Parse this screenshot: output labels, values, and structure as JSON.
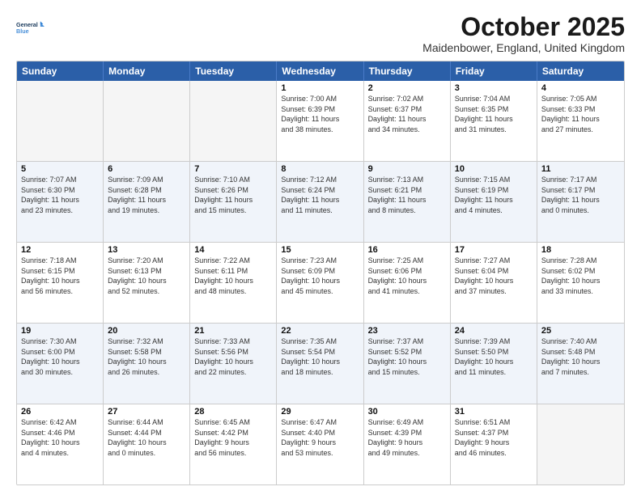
{
  "logo": {
    "line1": "General",
    "line2": "Blue"
  },
  "title": "October 2025",
  "location": "Maidenbower, England, United Kingdom",
  "weekdays": [
    "Sunday",
    "Monday",
    "Tuesday",
    "Wednesday",
    "Thursday",
    "Friday",
    "Saturday"
  ],
  "weeks": [
    [
      {
        "day": "",
        "info": ""
      },
      {
        "day": "",
        "info": ""
      },
      {
        "day": "",
        "info": ""
      },
      {
        "day": "1",
        "info": "Sunrise: 7:00 AM\nSunset: 6:39 PM\nDaylight: 11 hours\nand 38 minutes."
      },
      {
        "day": "2",
        "info": "Sunrise: 7:02 AM\nSunset: 6:37 PM\nDaylight: 11 hours\nand 34 minutes."
      },
      {
        "day": "3",
        "info": "Sunrise: 7:04 AM\nSunset: 6:35 PM\nDaylight: 11 hours\nand 31 minutes."
      },
      {
        "day": "4",
        "info": "Sunrise: 7:05 AM\nSunset: 6:33 PM\nDaylight: 11 hours\nand 27 minutes."
      }
    ],
    [
      {
        "day": "5",
        "info": "Sunrise: 7:07 AM\nSunset: 6:30 PM\nDaylight: 11 hours\nand 23 minutes."
      },
      {
        "day": "6",
        "info": "Sunrise: 7:09 AM\nSunset: 6:28 PM\nDaylight: 11 hours\nand 19 minutes."
      },
      {
        "day": "7",
        "info": "Sunrise: 7:10 AM\nSunset: 6:26 PM\nDaylight: 11 hours\nand 15 minutes."
      },
      {
        "day": "8",
        "info": "Sunrise: 7:12 AM\nSunset: 6:24 PM\nDaylight: 11 hours\nand 11 minutes."
      },
      {
        "day": "9",
        "info": "Sunrise: 7:13 AM\nSunset: 6:21 PM\nDaylight: 11 hours\nand 8 minutes."
      },
      {
        "day": "10",
        "info": "Sunrise: 7:15 AM\nSunset: 6:19 PM\nDaylight: 11 hours\nand 4 minutes."
      },
      {
        "day": "11",
        "info": "Sunrise: 7:17 AM\nSunset: 6:17 PM\nDaylight: 11 hours\nand 0 minutes."
      }
    ],
    [
      {
        "day": "12",
        "info": "Sunrise: 7:18 AM\nSunset: 6:15 PM\nDaylight: 10 hours\nand 56 minutes."
      },
      {
        "day": "13",
        "info": "Sunrise: 7:20 AM\nSunset: 6:13 PM\nDaylight: 10 hours\nand 52 minutes."
      },
      {
        "day": "14",
        "info": "Sunrise: 7:22 AM\nSunset: 6:11 PM\nDaylight: 10 hours\nand 48 minutes."
      },
      {
        "day": "15",
        "info": "Sunrise: 7:23 AM\nSunset: 6:09 PM\nDaylight: 10 hours\nand 45 minutes."
      },
      {
        "day": "16",
        "info": "Sunrise: 7:25 AM\nSunset: 6:06 PM\nDaylight: 10 hours\nand 41 minutes."
      },
      {
        "day": "17",
        "info": "Sunrise: 7:27 AM\nSunset: 6:04 PM\nDaylight: 10 hours\nand 37 minutes."
      },
      {
        "day": "18",
        "info": "Sunrise: 7:28 AM\nSunset: 6:02 PM\nDaylight: 10 hours\nand 33 minutes."
      }
    ],
    [
      {
        "day": "19",
        "info": "Sunrise: 7:30 AM\nSunset: 6:00 PM\nDaylight: 10 hours\nand 30 minutes."
      },
      {
        "day": "20",
        "info": "Sunrise: 7:32 AM\nSunset: 5:58 PM\nDaylight: 10 hours\nand 26 minutes."
      },
      {
        "day": "21",
        "info": "Sunrise: 7:33 AM\nSunset: 5:56 PM\nDaylight: 10 hours\nand 22 minutes."
      },
      {
        "day": "22",
        "info": "Sunrise: 7:35 AM\nSunset: 5:54 PM\nDaylight: 10 hours\nand 18 minutes."
      },
      {
        "day": "23",
        "info": "Sunrise: 7:37 AM\nSunset: 5:52 PM\nDaylight: 10 hours\nand 15 minutes."
      },
      {
        "day": "24",
        "info": "Sunrise: 7:39 AM\nSunset: 5:50 PM\nDaylight: 10 hours\nand 11 minutes."
      },
      {
        "day": "25",
        "info": "Sunrise: 7:40 AM\nSunset: 5:48 PM\nDaylight: 10 hours\nand 7 minutes."
      }
    ],
    [
      {
        "day": "26",
        "info": "Sunrise: 6:42 AM\nSunset: 4:46 PM\nDaylight: 10 hours\nand 4 minutes."
      },
      {
        "day": "27",
        "info": "Sunrise: 6:44 AM\nSunset: 4:44 PM\nDaylight: 10 hours\nand 0 minutes."
      },
      {
        "day": "28",
        "info": "Sunrise: 6:45 AM\nSunset: 4:42 PM\nDaylight: 9 hours\nand 56 minutes."
      },
      {
        "day": "29",
        "info": "Sunrise: 6:47 AM\nSunset: 4:40 PM\nDaylight: 9 hours\nand 53 minutes."
      },
      {
        "day": "30",
        "info": "Sunrise: 6:49 AM\nSunset: 4:39 PM\nDaylight: 9 hours\nand 49 minutes."
      },
      {
        "day": "31",
        "info": "Sunrise: 6:51 AM\nSunset: 4:37 PM\nDaylight: 9 hours\nand 46 minutes."
      },
      {
        "day": "",
        "info": ""
      }
    ]
  ]
}
